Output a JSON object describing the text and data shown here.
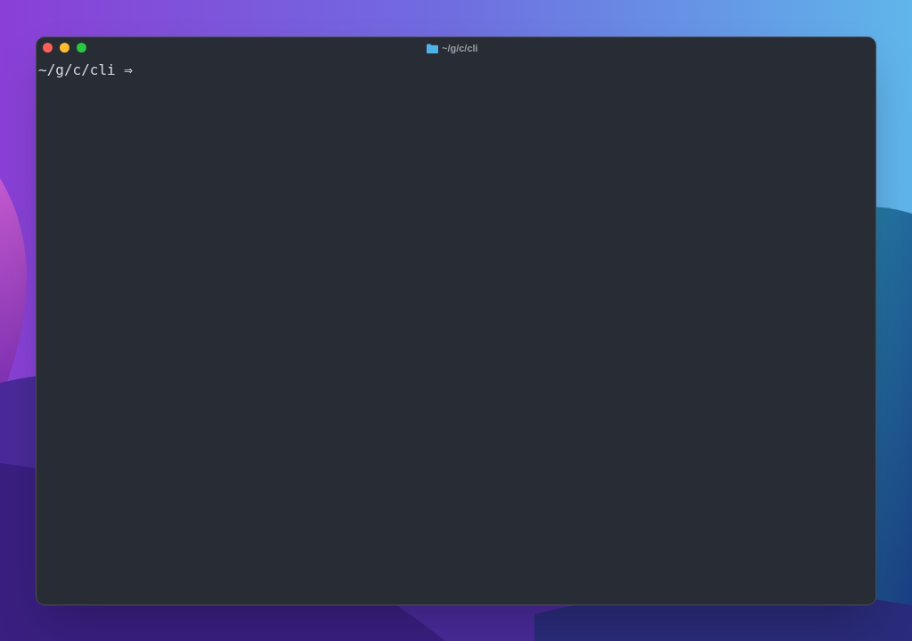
{
  "window": {
    "title": "~/g/c/cli"
  },
  "terminal": {
    "lines": [
      "~/g/c/cli ⇒"
    ]
  }
}
